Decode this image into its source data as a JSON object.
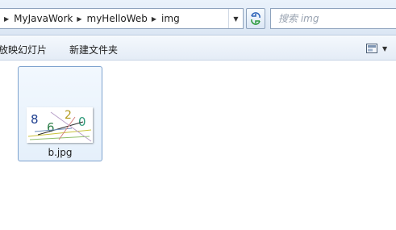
{
  "address_bar": {
    "breadcrumbs": [
      "MyJavaWork",
      "myHelloWeb",
      "img"
    ]
  },
  "search": {
    "placeholder": "搜索 img"
  },
  "command_bar": {
    "slideshow_label": "放映幻灯片",
    "new_folder_label": "新建文件夹"
  },
  "icons": {
    "breadcrumb_separator": "chevron-right-icon",
    "address_dropdown": "chevron-down-icon",
    "refresh": "refresh-icon",
    "view_options": "view-options-icon"
  },
  "files": [
    {
      "name": "b.jpg",
      "thumbnail_characters": [
        "8",
        "6",
        "2",
        "0"
      ]
    }
  ],
  "colors": {
    "selection_border": "#7da2ce",
    "selection_fill": "#e5f0fb",
    "toolbar_bg": "#dbe6f4"
  }
}
